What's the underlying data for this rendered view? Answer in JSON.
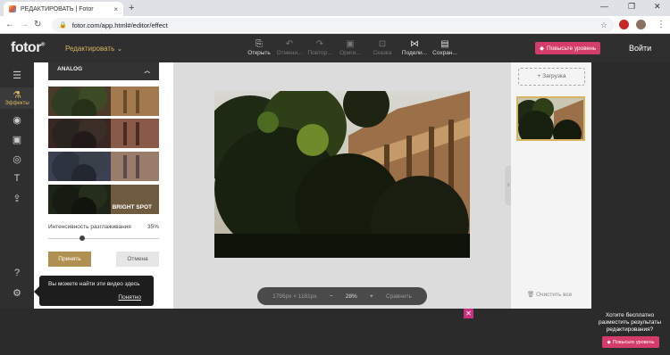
{
  "browser": {
    "tab_title": "РЕДАКТИРОВАТЬ | Fotor",
    "url": "fotor.com/app.html#/editor/effect",
    "tab_close": "×",
    "new_tab": "+",
    "back": "←",
    "forward": "→",
    "reload": "↻",
    "minimize": "—",
    "maximize": "❐",
    "close": "✕"
  },
  "header": {
    "logo": "fotor",
    "logo_mark": "®",
    "mode_label": "Редактировать",
    "tools": [
      {
        "label": "Открыть",
        "icon": "open-icon"
      },
      {
        "label": "Отмени...",
        "icon": "undo-icon"
      },
      {
        "label": "Повтор...",
        "icon": "redo-icon"
      },
      {
        "label": "Ориги...",
        "icon": "original-icon"
      },
      {
        "label": "Сказка",
        "icon": "compare-icon"
      },
      {
        "label": "Подели...",
        "icon": "share-icon"
      },
      {
        "label": "Сохран...",
        "icon": "save-icon"
      }
    ],
    "premium_label": "Повысьте уровень",
    "login_label": "Войти"
  },
  "rail": {
    "active_label": "Эффекты"
  },
  "effects_panel": {
    "section_title": "ANALOG",
    "thumb_label": "BRIGHT SPOT",
    "intensity_label": "Интенсивность разглаживания",
    "intensity_value": "35%",
    "intensity_fraction": 0.35,
    "apply_label": "Принять",
    "cancel_label": "Отмена"
  },
  "tooltip": {
    "text": "Вы можете найти эти видео здесь",
    "ok_label": "Понятно"
  },
  "canvas": {
    "dimensions": "1796px × 1181px",
    "zoom_out": "−",
    "zoom": "28%",
    "zoom_in": "+",
    "compare_label": "Сравнить"
  },
  "right_panel": {
    "upload_label": "+ Загрузка",
    "clear_label": "Очистить все"
  },
  "promo": {
    "text": "Хотите бесплатно разместить результаты редактирования?",
    "button_label": "Повысьте уровень",
    "close_glyph": "✕"
  },
  "colors": {
    "accent_gold": "#d8b461",
    "premium_pink": "#d43c69",
    "apply_brown": "#b09050"
  }
}
